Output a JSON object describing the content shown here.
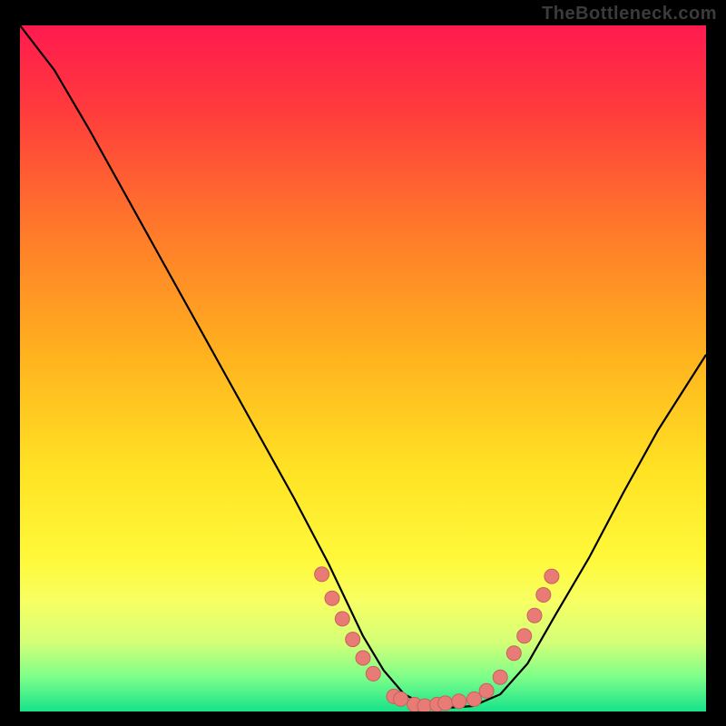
{
  "watermark": "TheBottleneck.com",
  "colors": {
    "background": "#000000",
    "curve": "#000000",
    "marker_fill": "#e97b77",
    "marker_stroke": "#c9605c",
    "gradient_stops": [
      {
        "offset": 0.0,
        "color": "#ff1a4f"
      },
      {
        "offset": 0.12,
        "color": "#ff3a3d"
      },
      {
        "offset": 0.3,
        "color": "#ff7a2a"
      },
      {
        "offset": 0.48,
        "color": "#ffb21e"
      },
      {
        "offset": 0.65,
        "color": "#ffe324"
      },
      {
        "offset": 0.78,
        "color": "#fff93b"
      },
      {
        "offset": 0.84,
        "color": "#f7ff63"
      },
      {
        "offset": 0.9,
        "color": "#d3ff77"
      },
      {
        "offset": 0.95,
        "color": "#7cff8a"
      },
      {
        "offset": 1.0,
        "color": "#17e28a"
      }
    ]
  },
  "chart_data": {
    "type": "line",
    "title": "",
    "xlabel": "",
    "ylabel": "",
    "x": [
      0.0,
      0.05,
      0.1,
      0.15,
      0.2,
      0.25,
      0.3,
      0.35,
      0.4,
      0.45,
      0.5,
      0.53,
      0.56,
      0.59,
      0.62,
      0.66,
      0.7,
      0.74,
      0.78,
      0.83,
      0.88,
      0.93,
      1.0
    ],
    "values": [
      1.0,
      0.935,
      0.85,
      0.76,
      0.67,
      0.58,
      0.49,
      0.4,
      0.31,
      0.215,
      0.11,
      0.06,
      0.025,
      0.01,
      0.005,
      0.008,
      0.025,
      0.07,
      0.14,
      0.225,
      0.32,
      0.41,
      0.52
    ],
    "xlim": [
      0,
      1
    ],
    "ylim": [
      0,
      1
    ],
    "markers": [
      {
        "x": 0.44,
        "y": 0.2
      },
      {
        "x": 0.455,
        "y": 0.165
      },
      {
        "x": 0.47,
        "y": 0.135
      },
      {
        "x": 0.485,
        "y": 0.105
      },
      {
        "x": 0.5,
        "y": 0.078
      },
      {
        "x": 0.515,
        "y": 0.055
      },
      {
        "x": 0.545,
        "y": 0.022
      },
      {
        "x": 0.555,
        "y": 0.018
      },
      {
        "x": 0.575,
        "y": 0.01
      },
      {
        "x": 0.59,
        "y": 0.008
      },
      {
        "x": 0.608,
        "y": 0.01
      },
      {
        "x": 0.62,
        "y": 0.012
      },
      {
        "x": 0.64,
        "y": 0.015
      },
      {
        "x": 0.662,
        "y": 0.018
      },
      {
        "x": 0.68,
        "y": 0.03
      },
      {
        "x": 0.7,
        "y": 0.05
      },
      {
        "x": 0.72,
        "y": 0.085
      },
      {
        "x": 0.735,
        "y": 0.11
      },
      {
        "x": 0.75,
        "y": 0.14
      },
      {
        "x": 0.763,
        "y": 0.17
      },
      {
        "x": 0.775,
        "y": 0.197
      }
    ]
  }
}
